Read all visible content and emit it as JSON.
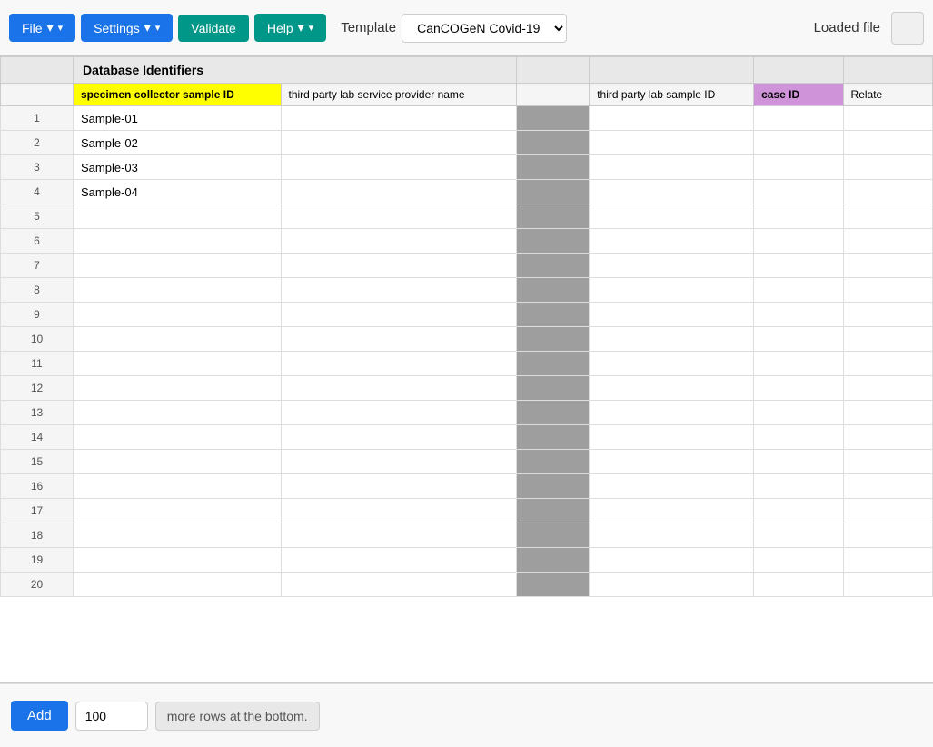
{
  "toolbar": {
    "file_label": "File",
    "settings_label": "Settings",
    "validate_label": "Validate",
    "help_label": "Help",
    "template_label": "Template",
    "template_value": "CanCOGeN Covid-19",
    "loaded_file_label": "Loaded file"
  },
  "spreadsheet": {
    "group_header": "Database Identifiers",
    "columns": [
      {
        "id": "specimen_collector_sample_id",
        "label": "specimen collector sample ID",
        "style": "highlighted"
      },
      {
        "id": "third_party_lab_service_provider_name",
        "label": "third party lab service provider name",
        "style": "normal"
      },
      {
        "id": "third_party_lab_sample_id",
        "label": "third party lab sample ID",
        "style": "normal"
      },
      {
        "id": "case_id",
        "label": "case ID",
        "style": "purple"
      },
      {
        "id": "related",
        "label": "Relate",
        "style": "normal"
      }
    ],
    "rows": [
      {
        "num": 1,
        "cells": [
          "Sample-01",
          "",
          "",
          "",
          ""
        ]
      },
      {
        "num": 2,
        "cells": [
          "Sample-02",
          "",
          "",
          "",
          ""
        ]
      },
      {
        "num": 3,
        "cells": [
          "Sample-03",
          "",
          "",
          "",
          ""
        ]
      },
      {
        "num": 4,
        "cells": [
          "Sample-04",
          "",
          "",
          "",
          ""
        ]
      },
      {
        "num": 5,
        "cells": [
          "",
          "",
          "",
          "",
          ""
        ]
      },
      {
        "num": 6,
        "cells": [
          "",
          "",
          "",
          "",
          ""
        ]
      },
      {
        "num": 7,
        "cells": [
          "",
          "",
          "",
          "",
          ""
        ]
      },
      {
        "num": 8,
        "cells": [
          "",
          "",
          "",
          "",
          ""
        ]
      },
      {
        "num": 9,
        "cells": [
          "",
          "",
          "",
          "",
          ""
        ]
      },
      {
        "num": 10,
        "cells": [
          "",
          "",
          "",
          "",
          ""
        ]
      },
      {
        "num": 11,
        "cells": [
          "",
          "",
          "",
          "",
          ""
        ]
      },
      {
        "num": 12,
        "cells": [
          "",
          "",
          "",
          "",
          ""
        ]
      },
      {
        "num": 13,
        "cells": [
          "",
          "",
          "",
          "",
          ""
        ]
      },
      {
        "num": 14,
        "cells": [
          "",
          "",
          "",
          "",
          ""
        ]
      },
      {
        "num": 15,
        "cells": [
          "",
          "",
          "",
          "",
          ""
        ]
      },
      {
        "num": 16,
        "cells": [
          "",
          "",
          "",
          "",
          ""
        ]
      },
      {
        "num": 17,
        "cells": [
          "",
          "",
          "",
          "",
          ""
        ]
      },
      {
        "num": 18,
        "cells": [
          "",
          "",
          "",
          "",
          ""
        ]
      },
      {
        "num": 19,
        "cells": [
          "",
          "",
          "",
          "",
          ""
        ]
      },
      {
        "num": 20,
        "cells": [
          "",
          "",
          "",
          "",
          ""
        ]
      }
    ]
  },
  "bottom_bar": {
    "add_label": "Add",
    "rows_value": "100",
    "rows_suffix_label": "more rows at the bottom."
  }
}
